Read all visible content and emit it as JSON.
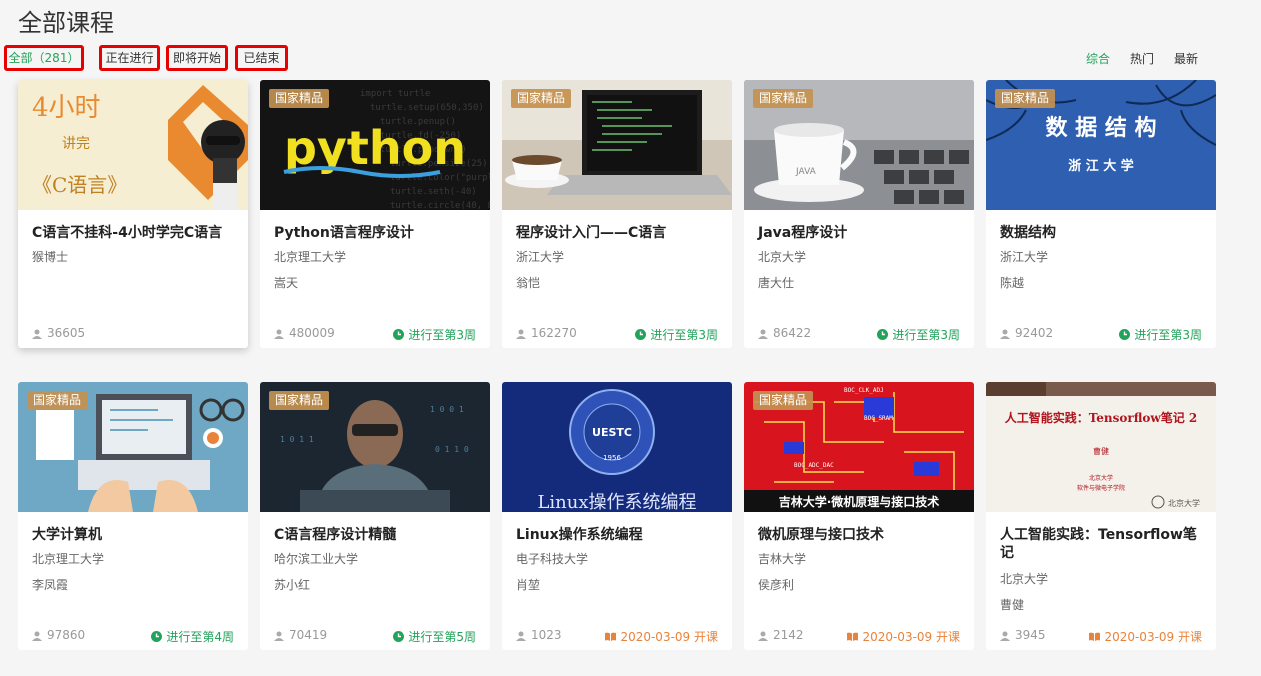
{
  "page": {
    "title": "全部课程"
  },
  "filters": [
    {
      "label": "全部（281）",
      "active": true
    },
    {
      "label": "正在进行",
      "active": false
    },
    {
      "label": "即将开始",
      "active": false
    },
    {
      "label": "已结束",
      "active": false
    }
  ],
  "sort": [
    {
      "label": "综合",
      "active": true
    },
    {
      "label": "热门",
      "active": false
    },
    {
      "label": "最新",
      "active": false
    }
  ],
  "colors": {
    "accent_green": "#22a35a",
    "status_orange": "#e8833a",
    "badge": "#c49150",
    "filter_outline": "#e60000"
  },
  "courses": [
    {
      "title": "C语言不挂科-4小时学完C语言",
      "school": "猴博士",
      "teacher": "",
      "count": "36605",
      "status": "",
      "status_type": "none",
      "badge": "",
      "cover_text": [
        "4小时",
        "讲完",
        "《C语言》"
      ]
    },
    {
      "title": "Python语言程序设计",
      "school": "北京理工大学",
      "teacher": "嵩天",
      "count": "480009",
      "status": "进行至第3周",
      "status_type": "ongoing",
      "badge": "国家精品",
      "cover_text": [
        "python"
      ]
    },
    {
      "title": "程序设计入门——C语言",
      "school": "浙江大学",
      "teacher": "翁恺",
      "count": "162270",
      "status": "进行至第3周",
      "status_type": "ongoing",
      "badge": "国家精品",
      "cover_text": []
    },
    {
      "title": "Java程序设计",
      "school": "北京大学",
      "teacher": "唐大仕",
      "count": "86422",
      "status": "进行至第3周",
      "status_type": "ongoing",
      "badge": "国家精品",
      "cover_text": [
        "JAVA"
      ]
    },
    {
      "title": "数据结构",
      "school": "浙江大学",
      "teacher": "陈越",
      "count": "92402",
      "status": "进行至第3周",
      "status_type": "ongoing",
      "badge": "国家精品",
      "cover_text": [
        "数 据 结 构",
        "浙 江 大 学"
      ]
    },
    {
      "title": "大学计算机",
      "school": "北京理工大学",
      "teacher": "李凤霞",
      "count": "97860",
      "status": "进行至第4周",
      "status_type": "ongoing",
      "badge": "国家精品",
      "cover_text": []
    },
    {
      "title": "C语言程序设计精髓",
      "school": "哈尔滨工业大学",
      "teacher": "苏小红",
      "count": "70419",
      "status": "进行至第5周",
      "status_type": "ongoing",
      "badge": "国家精品",
      "cover_text": []
    },
    {
      "title": "Linux操作系统编程",
      "school": "电子科技大学",
      "teacher": "肖堃",
      "count": "1023",
      "status": "2020-03-09 开课",
      "status_type": "upcoming",
      "badge": "",
      "cover_text": [
        "UESTC",
        "1956",
        "Linux操作系统编程"
      ]
    },
    {
      "title": "微机原理与接口技术",
      "school": "吉林大学",
      "teacher": "侯彦利",
      "count": "2142",
      "status": "2020-03-09 开课",
      "status_type": "upcoming",
      "badge": "国家精品",
      "cover_text": [
        "吉林大学·微机原理与接口技术"
      ]
    },
    {
      "title": "人工智能实践：Tensorflow笔记",
      "school": "北京大学",
      "teacher": "曹健",
      "count": "3945",
      "status": "2020-03-09 开课",
      "status_type": "upcoming",
      "badge": "",
      "cover_text": [
        "人工智能实践：Tensorflow笔记 2",
        "曹健",
        "北京大学",
        "软件与微电子学院",
        "北京大学"
      ]
    }
  ]
}
